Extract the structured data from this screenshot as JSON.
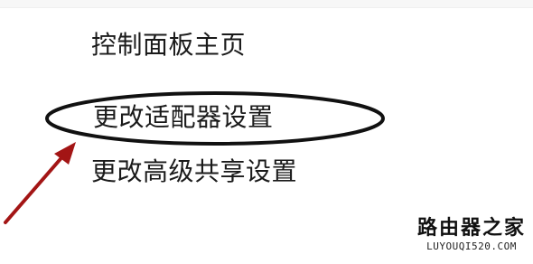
{
  "control_panel": {
    "links": {
      "home": "控制面板主页",
      "change_adapter_settings": "更改适配器设置",
      "change_advanced_sharing_settings": "更改高级共享设置"
    }
  },
  "annotation": {
    "highlight_target": "change_adapter_settings",
    "color": "#a31515",
    "ellipse_color": "#111111"
  },
  "watermark": {
    "title": "路由器之家",
    "url": "LUYOUQI520.COM"
  }
}
